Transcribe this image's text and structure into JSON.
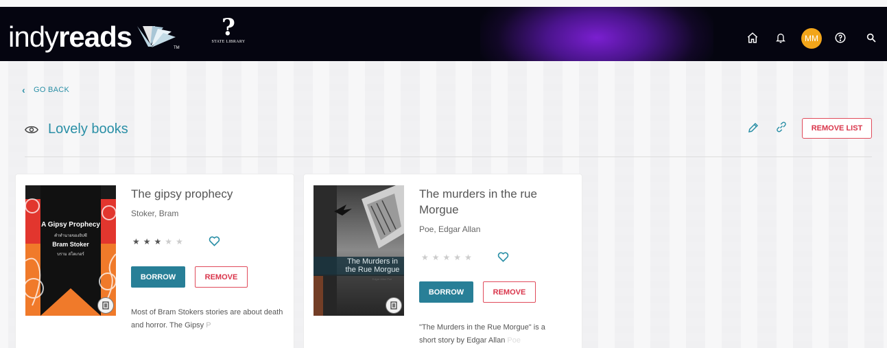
{
  "header": {
    "logo_light": "indy",
    "logo_bold": "reads",
    "logo_tm": "TM",
    "partner_symbol": "?",
    "partner_name": "STATE LIBRARY",
    "avatar_initials": "MM",
    "icons": [
      "home-icon",
      "bell-icon",
      "help-icon",
      "search-icon"
    ]
  },
  "nav": {
    "go_back": "GO BACK"
  },
  "list": {
    "title": "Lovely books",
    "remove_label": "REMOVE LIST"
  },
  "books": [
    {
      "title": "The gipsy prophecy",
      "author": "Stoker, Bram",
      "rating": 3,
      "rating_max": 5,
      "borrow_label": "BORROW",
      "remove_label": "REMOVE",
      "description": "Most of Bram Stokers stories are about death and horror. The Gipsy",
      "description_fade": "P",
      "cover": {
        "title": "A Gipsy Prophecy",
        "thai_line_1": "คำทำนายของยิปซี",
        "author": "Bram Stoker",
        "thai_line_2": "บราม สโตเกอร์"
      }
    },
    {
      "title": "The murders in the rue Morgue",
      "author": "Poe, Edgar Allan",
      "rating": 0,
      "rating_max": 5,
      "borrow_label": "BORROW",
      "remove_label": "REMOVE",
      "description_1": "\"The Murders in the Rue Morgue\" is a",
      "description_2": "short story by Edgar Allan",
      "description_fade": "Poe",
      "cover": {
        "title_1": "The Murders in",
        "title_2": "the Rue Morgue",
        "author": "Edgar Allan Poe"
      }
    }
  ],
  "colors": {
    "accent": "#2a8fa6",
    "button": "#287f97",
    "danger": "#d9344a",
    "avatar": "#f2a51a",
    "header_bg": "#050510",
    "header_glow": "#7a1fd0"
  }
}
